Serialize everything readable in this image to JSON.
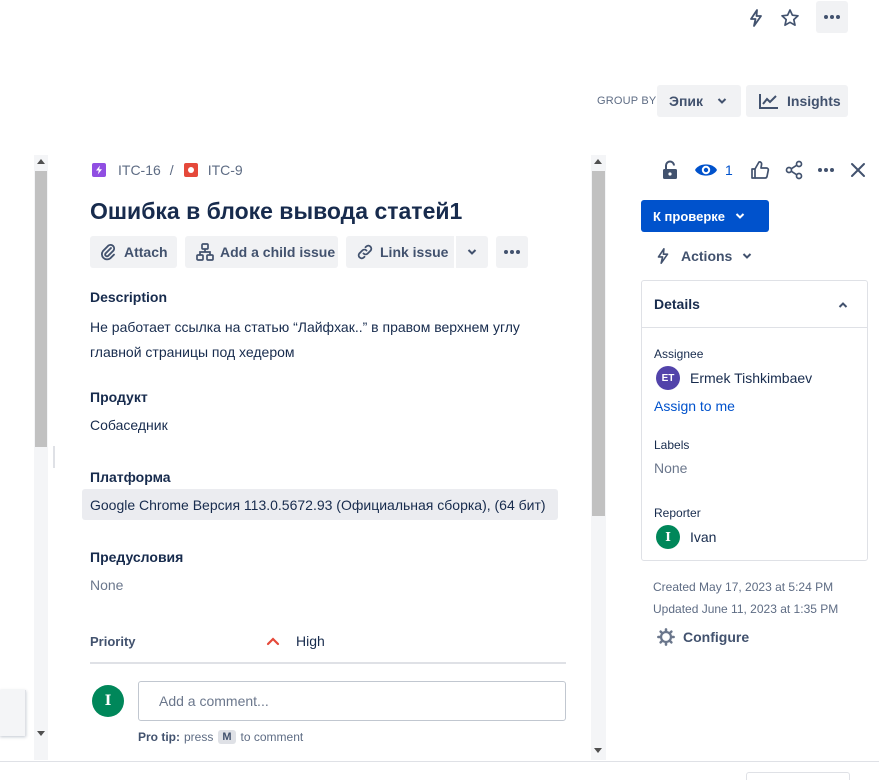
{
  "top_bar": {
    "group_by_label": "GROUP BY",
    "group_by_value": "Эпик",
    "insights_label": "Insights"
  },
  "issue": {
    "breadcrumb": [
      {
        "key": "ITC-16",
        "icon": "epic-icon",
        "color": "#904ee2"
      },
      {
        "key": "ITC-9",
        "icon": "bug-icon",
        "color": "#e5493a"
      }
    ],
    "breadcrumb_separator": "/",
    "title": "Ошибка в блоке вывода статей1",
    "actions": {
      "attach": "Attach",
      "add_child": "Add a child issue",
      "link_issue": "Link issue"
    },
    "description_label": "Description",
    "description_line1": "Не работает ссылка на статью “Лайфхак..” в правом верхнем углу",
    "description_line2": "главной страницы под хедером",
    "product_label": "Продукт",
    "product_value": "Собаседник",
    "platform_label": "Платформа",
    "platform_value": "Google Chrome Версия 113.0.5672.93 (Официальная сборка), (64 бит)",
    "preconditions_label": "Предусловия",
    "preconditions_value": "None",
    "priority_label": "Priority",
    "priority_value": "High",
    "priority_color": "#e5493a",
    "comment": {
      "avatar_letter": "I",
      "placeholder": "Add a comment...",
      "pro_tip_label": "Pro tip:",
      "pro_tip_press": "press",
      "pro_tip_key": "M",
      "pro_tip_suffix": "to comment"
    }
  },
  "side_panel": {
    "watch_count": "1",
    "status_label": "К проверке",
    "status_color": "#0052cc",
    "actions_label": "Actions",
    "details": {
      "header": "Details",
      "assignee_label": "Assignee",
      "assignee_initials": "ET",
      "assignee_name": "Ermek Tishkimbaev",
      "assignee_avatar_color": "#5243aa",
      "assign_to_me": "Assign to me",
      "labels_label": "Labels",
      "labels_value": "None",
      "reporter_label": "Reporter",
      "reporter_initial": "I",
      "reporter_name": "Ivan",
      "reporter_avatar_color": "#00875a"
    },
    "created": "Created May 17, 2023 at 5:24 PM",
    "updated": "Updated June 11, 2023 at 1:35 PM",
    "configure_label": "Configure"
  }
}
